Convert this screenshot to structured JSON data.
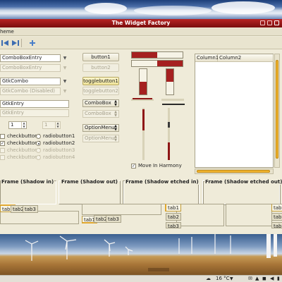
{
  "window": {
    "title": "The Widget Factory"
  },
  "menubar": {
    "item": "heme"
  },
  "column1": {
    "combo_entry": "ComboBoxEntry",
    "combo_entry_disabled": "ComboBoxEntry",
    "combo": "GtkCombo",
    "combo_disabled": "GtkCombo (Disabled)",
    "entry": "GtkEntry",
    "entry_disabled": "GtkEntry",
    "spin_value": "1",
    "spin_disabled_value": "1",
    "checkbuttons": [
      {
        "label": "checkbutton1",
        "checked": false
      },
      {
        "label": "checkbutton2",
        "checked": true
      },
      {
        "label": "checkbutton3",
        "checked": false
      },
      {
        "label": "checkbutton4",
        "checked": false
      }
    ],
    "radiobuttons": [
      {
        "label": "radiobutton1",
        "selected": false
      },
      {
        "label": "radiobutton2",
        "selected": true
      },
      {
        "label": "radiobutton3",
        "selected": false
      },
      {
        "label": "radiobutton4",
        "selected": false
      }
    ]
  },
  "column2": {
    "button1": "button1",
    "button2": "button2",
    "togglebutton1": "togglebutton1",
    "togglebutton2": "togglebutton2",
    "combobox": "ComboBox",
    "combobox_disabled": "ComboBox",
    "optionmenu": "OptionMenu",
    "optionmenu_disabled": "OptionMenu"
  },
  "column3": {
    "move_in_harmony": "Move In Harmony",
    "move_in_harmony_checked": true,
    "progress_h1": 0.5,
    "progress_h2": 0.5,
    "progress_v1": 0.5,
    "progress_v2": 0.5
  },
  "treeview": {
    "columns": [
      "Column1",
      "Column2"
    ]
  },
  "frames": [
    "Frame (Shadow in)",
    "Frame (Shadow out)",
    "Frame (Shadow etched in)",
    "Frame (Shadow etched out)"
  ],
  "notebooks": {
    "tabs": [
      "tab1",
      "tab2",
      "tab3"
    ]
  },
  "panel": {
    "weather": "16 °C"
  },
  "colors": {
    "accent": "#a52020",
    "scroll": "#f0b32e",
    "window_bg": "#efebd9",
    "titlebar": "#9a1717"
  }
}
